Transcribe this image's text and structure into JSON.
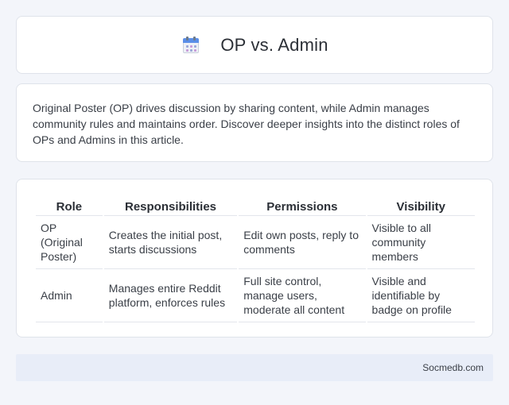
{
  "header": {
    "title": "OP vs. Admin",
    "icon": "calendar-icon"
  },
  "intro": {
    "text": "Original Poster (OP) drives discussion by sharing content, while Admin manages community rules and maintains order. Discover deeper insights into the distinct roles of OPs and Admins in this article."
  },
  "table": {
    "headers": [
      "Role",
      "Responsibilities",
      "Permissions",
      "Visibility"
    ],
    "rows": [
      [
        "OP (Original Poster)",
        "Creates the initial post, starts discussions",
        "Edit own posts, reply to comments",
        "Visible to all community members"
      ],
      [
        "Admin",
        "Manages entire Reddit platform, enforces rules",
        "Full site control, manage users, moderate all content",
        "Visible and identifiable by badge on profile"
      ]
    ]
  },
  "footer": {
    "text": "Socmedb.com"
  },
  "colors": {
    "background": "#f3f5fa",
    "card": "#ffffff",
    "footer_bg": "#e8edf8",
    "icon_accent": "#5b8fe8"
  }
}
